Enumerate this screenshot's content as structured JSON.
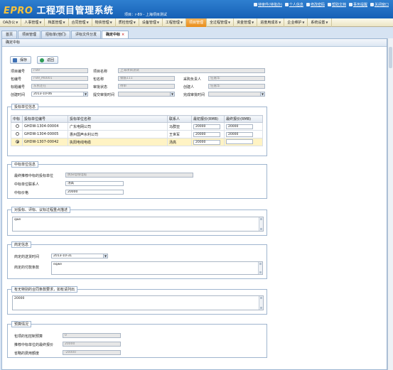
{
  "header": {
    "logo_prefix": "EPRO",
    "logo_title": "工程项目管理系统",
    "project_line": "项目：r-89 - 上海项目测试",
    "links": [
      "待审件(待批办)",
      "个人信息",
      "修改密码",
      "帮助文档",
      "事务提醒",
      "关闭窗口"
    ]
  },
  "menu": [
    {
      "label": "OA办公",
      "active": false
    },
    {
      "label": "人事管理",
      "active": false
    },
    {
      "label": "档案管理",
      "active": false
    },
    {
      "label": "合同管理",
      "active": false
    },
    {
      "label": "物资管理",
      "active": false
    },
    {
      "label": "质检管理",
      "active": false
    },
    {
      "label": "设备管理",
      "active": false
    },
    {
      "label": "工程管理",
      "active": false
    },
    {
      "label": "项目管理",
      "active": true
    },
    {
      "label": "全过程管理",
      "active": false
    },
    {
      "label": "资金管理",
      "active": false
    },
    {
      "label": "进度用成本",
      "active": false
    },
    {
      "label": "企业维护",
      "active": false
    },
    {
      "label": "系统设置",
      "active": false
    }
  ],
  "tabs": [
    {
      "label": "首页"
    },
    {
      "label": "项目管理"
    },
    {
      "label": "招标单(他们)"
    },
    {
      "label": "评标文件分发"
    },
    {
      "label": "确定中标"
    }
  ],
  "page_title": "确定中标",
  "buttons": {
    "save": "保存",
    "back": "返回"
  },
  "form": {
    "project_code": {
      "label": "项目编号",
      "value": "r-89"
    },
    "project_name": {
      "label": "项目名称",
      "value": "上海项目测试"
    },
    "package_code": {
      "label": "包编号",
      "value": "r-89_M0001"
    },
    "package_name": {
      "label": "包名称",
      "value": "钢筋111"
    },
    "purchase_owner": {
      "label": "采购负责人",
      "value": "任嘉华"
    },
    "bid_code": {
      "label": "标题编号",
      "value": "东民还在"
    },
    "approval_status": {
      "label": "审批状态",
      "value": "待审"
    },
    "creator": {
      "label": "创建人",
      "value": "任嘉华"
    },
    "create_time": {
      "label": "创建时间",
      "value": "2013-10-06"
    },
    "submit_time": {
      "label": "提交审批时间",
      "value": ""
    },
    "finish_time": {
      "label": "完成审批时间",
      "value": ""
    }
  },
  "bidder_section": {
    "legend": "投标单位信息",
    "columns": [
      "中标",
      "投标单位编号",
      "投标单位名称",
      "联系人",
      "最初报价(RMB)",
      "最终报价(RMB)"
    ],
    "rows": [
      {
        "code": "GHDW-1304-00004",
        "name": "广东电网公司",
        "contact": "马群亚",
        "first": "20000",
        "final": "20000",
        "selected": false
      },
      {
        "code": "GHDW-1304-00005",
        "name": "惠州国声水利公司",
        "contact": "王世军",
        "first": "20000",
        "final": "20000",
        "selected": false
      },
      {
        "code": "GHDW-1307-00042",
        "name": "执阳电线电缆",
        "contact": "汤高",
        "first": "20000",
        "final": "",
        "selected": true
      }
    ]
  },
  "winner_section": {
    "legend": "中标单位信息",
    "winner_label": "最终推荐中标的投标单位",
    "winner_value": "执阳电线电缆",
    "contact_label": "中标单位联系人",
    "contact_value": "汤高",
    "price_label": "中标价格",
    "price_value": "20000"
  },
  "evaluation": {
    "legend": "对投标、评标、议标过程重点描述",
    "value": "qwe"
  },
  "agreement": {
    "legend": "商定信息",
    "date_label": "商定的送货时间",
    "date_value": "2013-10-31",
    "terms_label": "商定的付款条款",
    "terms_value": "eqwe"
  },
  "contract": {
    "legend": "有无特别的合同条款要求，如有请列出",
    "value": "20000"
  },
  "budget": {
    "legend": "预算情况",
    "rows": [
      {
        "label": "包项的包控制预算",
        "value": "0"
      },
      {
        "label": "推荐中标单位的最终报价",
        "value": "20000"
      },
      {
        "label": "省略的费用额度",
        "value": "-20000"
      }
    ]
  }
}
